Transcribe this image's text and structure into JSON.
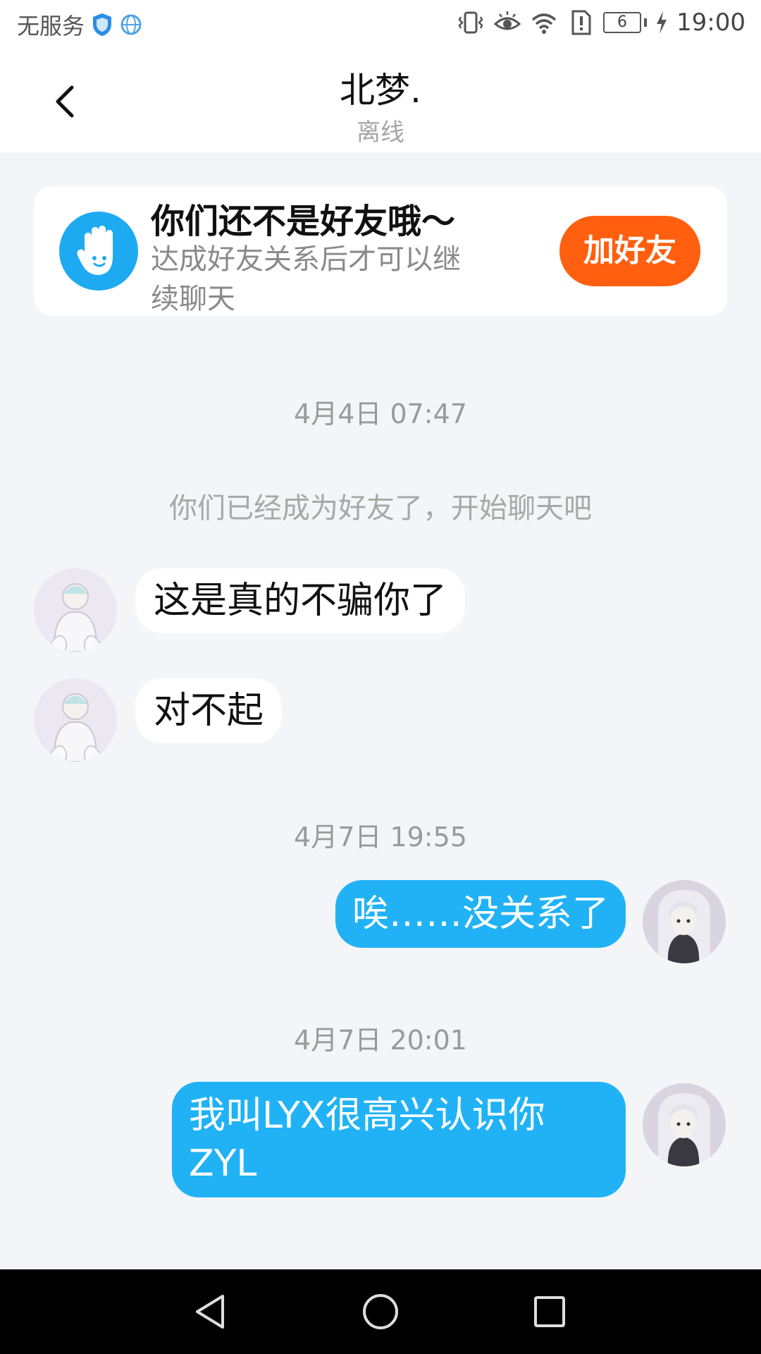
{
  "status_bar": {
    "carrier": "无服务",
    "battery": "6",
    "time": "19:00",
    "icons": [
      "shield-icon",
      "globe-icon",
      "vibrate-icon",
      "eye-icon",
      "wifi-icon",
      "alert-icon",
      "battery-icon",
      "charging-icon"
    ]
  },
  "header": {
    "title": "北梦.",
    "status": "离线"
  },
  "banner": {
    "title": "你们还不是好友哦～",
    "description": "达成好友关系后才可以继续聊天",
    "button": "加好友",
    "accent": "#ff5f0f",
    "icon": "hand-icon"
  },
  "messages": {
    "ts1": "4月4日 07:47",
    "system": "你们已经成为好友了，开始聊天吧",
    "m1": "这是真的不骗你了",
    "m2": "对不起",
    "ts2": "4月7日 19:55",
    "m3": "唉……没关系了",
    "ts3": "4月7日 20:01",
    "m4": "我叫LYX很高兴认识你ZYL"
  },
  "colors": {
    "outgoing_bubble": "#21b2f6",
    "background": "#f3f5f8"
  }
}
